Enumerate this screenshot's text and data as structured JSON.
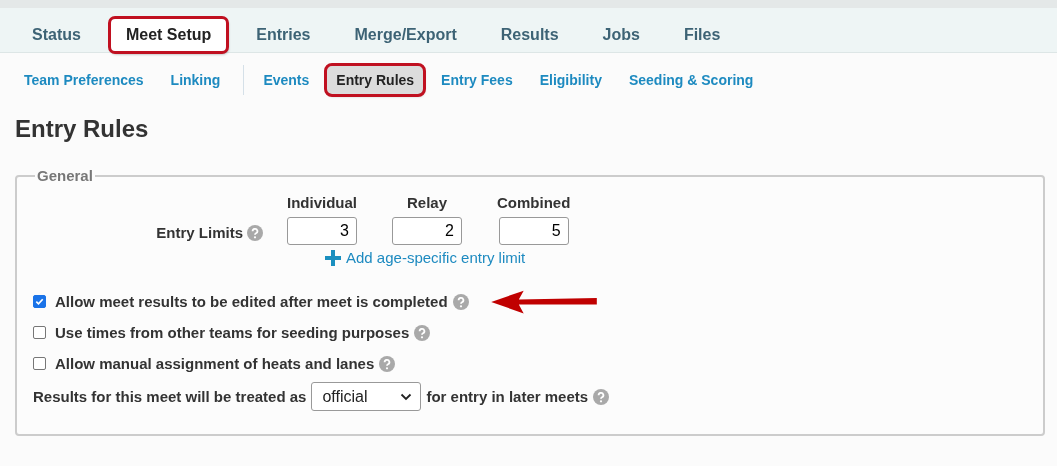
{
  "tabs": [
    {
      "label": "Status",
      "selected": false,
      "highlighted": false
    },
    {
      "label": "Meet Setup",
      "selected": true,
      "highlighted": true
    },
    {
      "label": "Entries",
      "selected": false,
      "highlighted": false
    },
    {
      "label": "Merge/Export",
      "selected": false,
      "highlighted": false
    },
    {
      "label": "Results",
      "selected": false,
      "highlighted": false
    },
    {
      "label": "Jobs",
      "selected": false,
      "highlighted": false
    },
    {
      "label": "Files",
      "selected": false,
      "highlighted": false
    }
  ],
  "subtabs": [
    {
      "label": "Team Preferences",
      "selected": false,
      "highlighted": false,
      "divider_after": false
    },
    {
      "label": "Linking",
      "selected": false,
      "highlighted": false,
      "divider_after": true
    },
    {
      "label": "Events",
      "selected": false,
      "highlighted": false,
      "divider_after": false
    },
    {
      "label": "Entry Rules",
      "selected": true,
      "highlighted": true,
      "divider_after": false
    },
    {
      "label": "Entry Fees",
      "selected": false,
      "highlighted": false,
      "divider_after": false
    },
    {
      "label": "Eligibility",
      "selected": false,
      "highlighted": false,
      "divider_after": false
    },
    {
      "label": "Seeding & Scoring",
      "selected": false,
      "highlighted": false,
      "divider_after": false
    }
  ],
  "page_title": "Entry Rules",
  "section": {
    "legend": "General",
    "entry_limits": {
      "label": "Entry Limits",
      "fields": [
        {
          "heading": "Individual",
          "value": "3"
        },
        {
          "heading": "Relay",
          "value": "2"
        },
        {
          "heading": "Combined",
          "value": "5"
        }
      ],
      "add_link": "Add age-specific entry limit"
    },
    "options": [
      {
        "label": "Allow meet results to be edited after meet is completed",
        "checked": true,
        "arrow": true
      },
      {
        "label": "Use times from other teams for seeding purposes",
        "checked": false,
        "arrow": false
      },
      {
        "label": "Allow manual assignment of heats and lanes",
        "checked": false,
        "arrow": false
      }
    ],
    "results_row": {
      "before": "Results for this meet will be treated as",
      "select": "official",
      "after": "for entry in later meets"
    }
  }
}
